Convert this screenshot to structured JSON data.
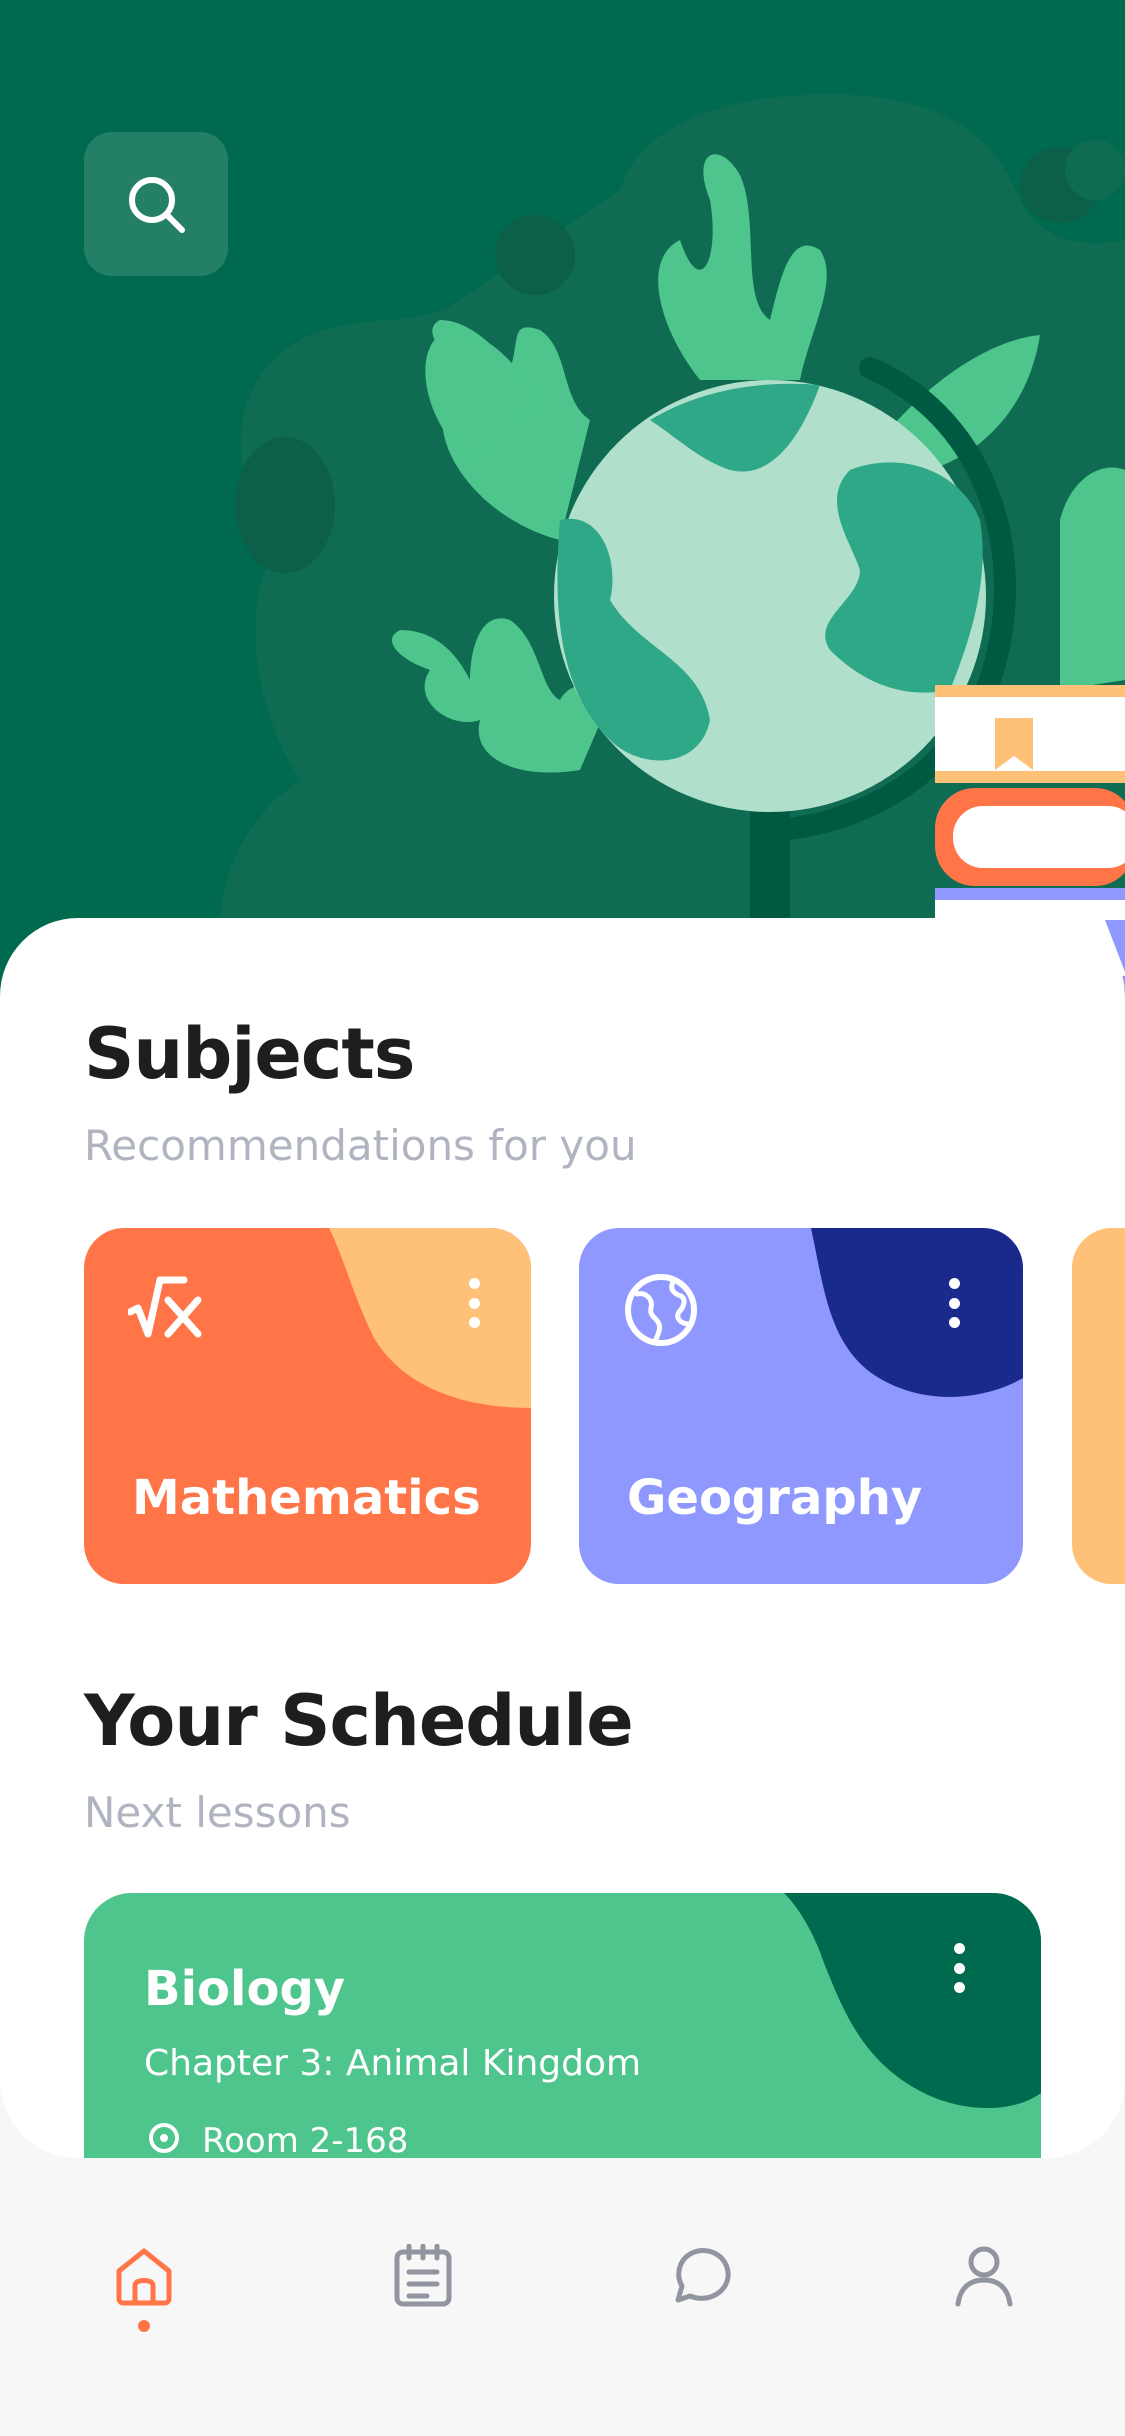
{
  "colors": {
    "hero_bg": "#006a4e",
    "math": "#ff7548",
    "math_accent": "#ffc077",
    "geography": "#8f98ff",
    "geography_accent": "#1a2a8c",
    "biology": "#4dc58c",
    "biology_accent": "#006a4e",
    "tab_active": "#ff7548",
    "tab_inactive": "#9095a0"
  },
  "header": {
    "search_icon": "search-icon"
  },
  "subjects": {
    "title": "Subjects",
    "subtitle": "Recommendations for you",
    "cards": [
      {
        "label": "Mathematics",
        "icon": "sqrt-x-icon"
      },
      {
        "label": "Geography",
        "icon": "globe-icon"
      }
    ]
  },
  "schedule": {
    "title": "Your Schedule",
    "subtitle": "Next lessons",
    "lessons": [
      {
        "subject": "Biology",
        "chapter": "Chapter 3: Animal Kingdom",
        "room": "Room 2-168"
      }
    ]
  },
  "tabbar": {
    "items": [
      {
        "name": "home",
        "icon": "home-icon",
        "active": true
      },
      {
        "name": "notes",
        "icon": "notepad-icon",
        "active": false
      },
      {
        "name": "chat",
        "icon": "chat-bubble-icon",
        "active": false
      },
      {
        "name": "profile",
        "icon": "user-icon",
        "active": false
      }
    ]
  }
}
